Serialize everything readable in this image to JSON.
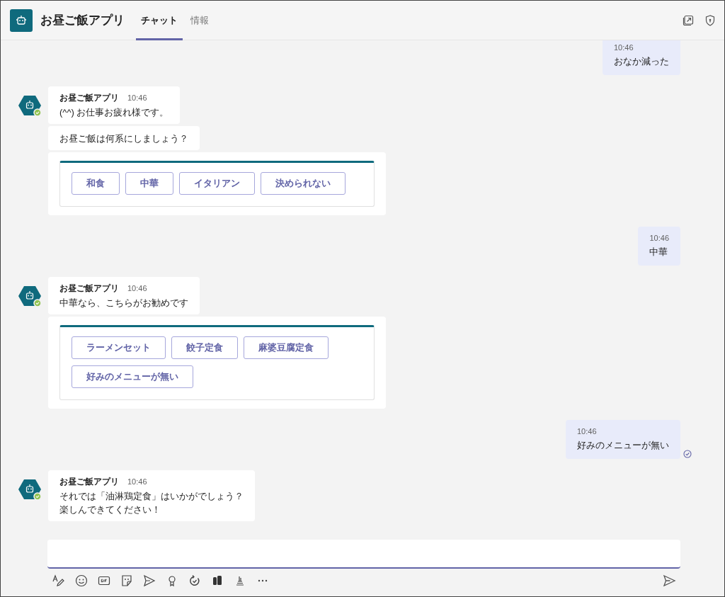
{
  "header": {
    "title": "お昼ご飯アプリ",
    "tabs": [
      {
        "label": "チャット",
        "selected": true
      },
      {
        "label": "情報",
        "selected": false
      }
    ]
  },
  "messages": [
    {
      "kind": "user",
      "time": "10:46",
      "text": "おなか減った",
      "read": false
    },
    {
      "kind": "bot",
      "sender": "お昼ご飯アプリ",
      "time": "10:46",
      "bubbles": [
        [
          "(^^) お仕事お疲れ様です。"
        ],
        [
          "お昼ご飯は何系にしましょう？"
        ]
      ],
      "card": {
        "buttons": [
          "和食",
          "中華",
          "イタリアン",
          "決められない"
        ]
      }
    },
    {
      "kind": "user",
      "time": "10:46",
      "text": "中華",
      "read": false
    },
    {
      "kind": "bot",
      "sender": "お昼ご飯アプリ",
      "time": "10:46",
      "bubbles": [
        [
          "中華なら、こちらがお勧めです"
        ]
      ],
      "card": {
        "buttons": [
          "ラーメンセット",
          "餃子定食",
          "麻婆豆腐定食",
          "好みのメニューが無い"
        ]
      }
    },
    {
      "kind": "user",
      "time": "10:46",
      "text": "好みのメニューが無い",
      "read": true
    },
    {
      "kind": "bot",
      "sender": "お昼ご飯アプリ",
      "time": "10:46",
      "bubbles": [
        [
          "それでは「油淋鶏定食」はいかがでしょう？",
          "楽しんできてください！"
        ]
      ]
    }
  ]
}
